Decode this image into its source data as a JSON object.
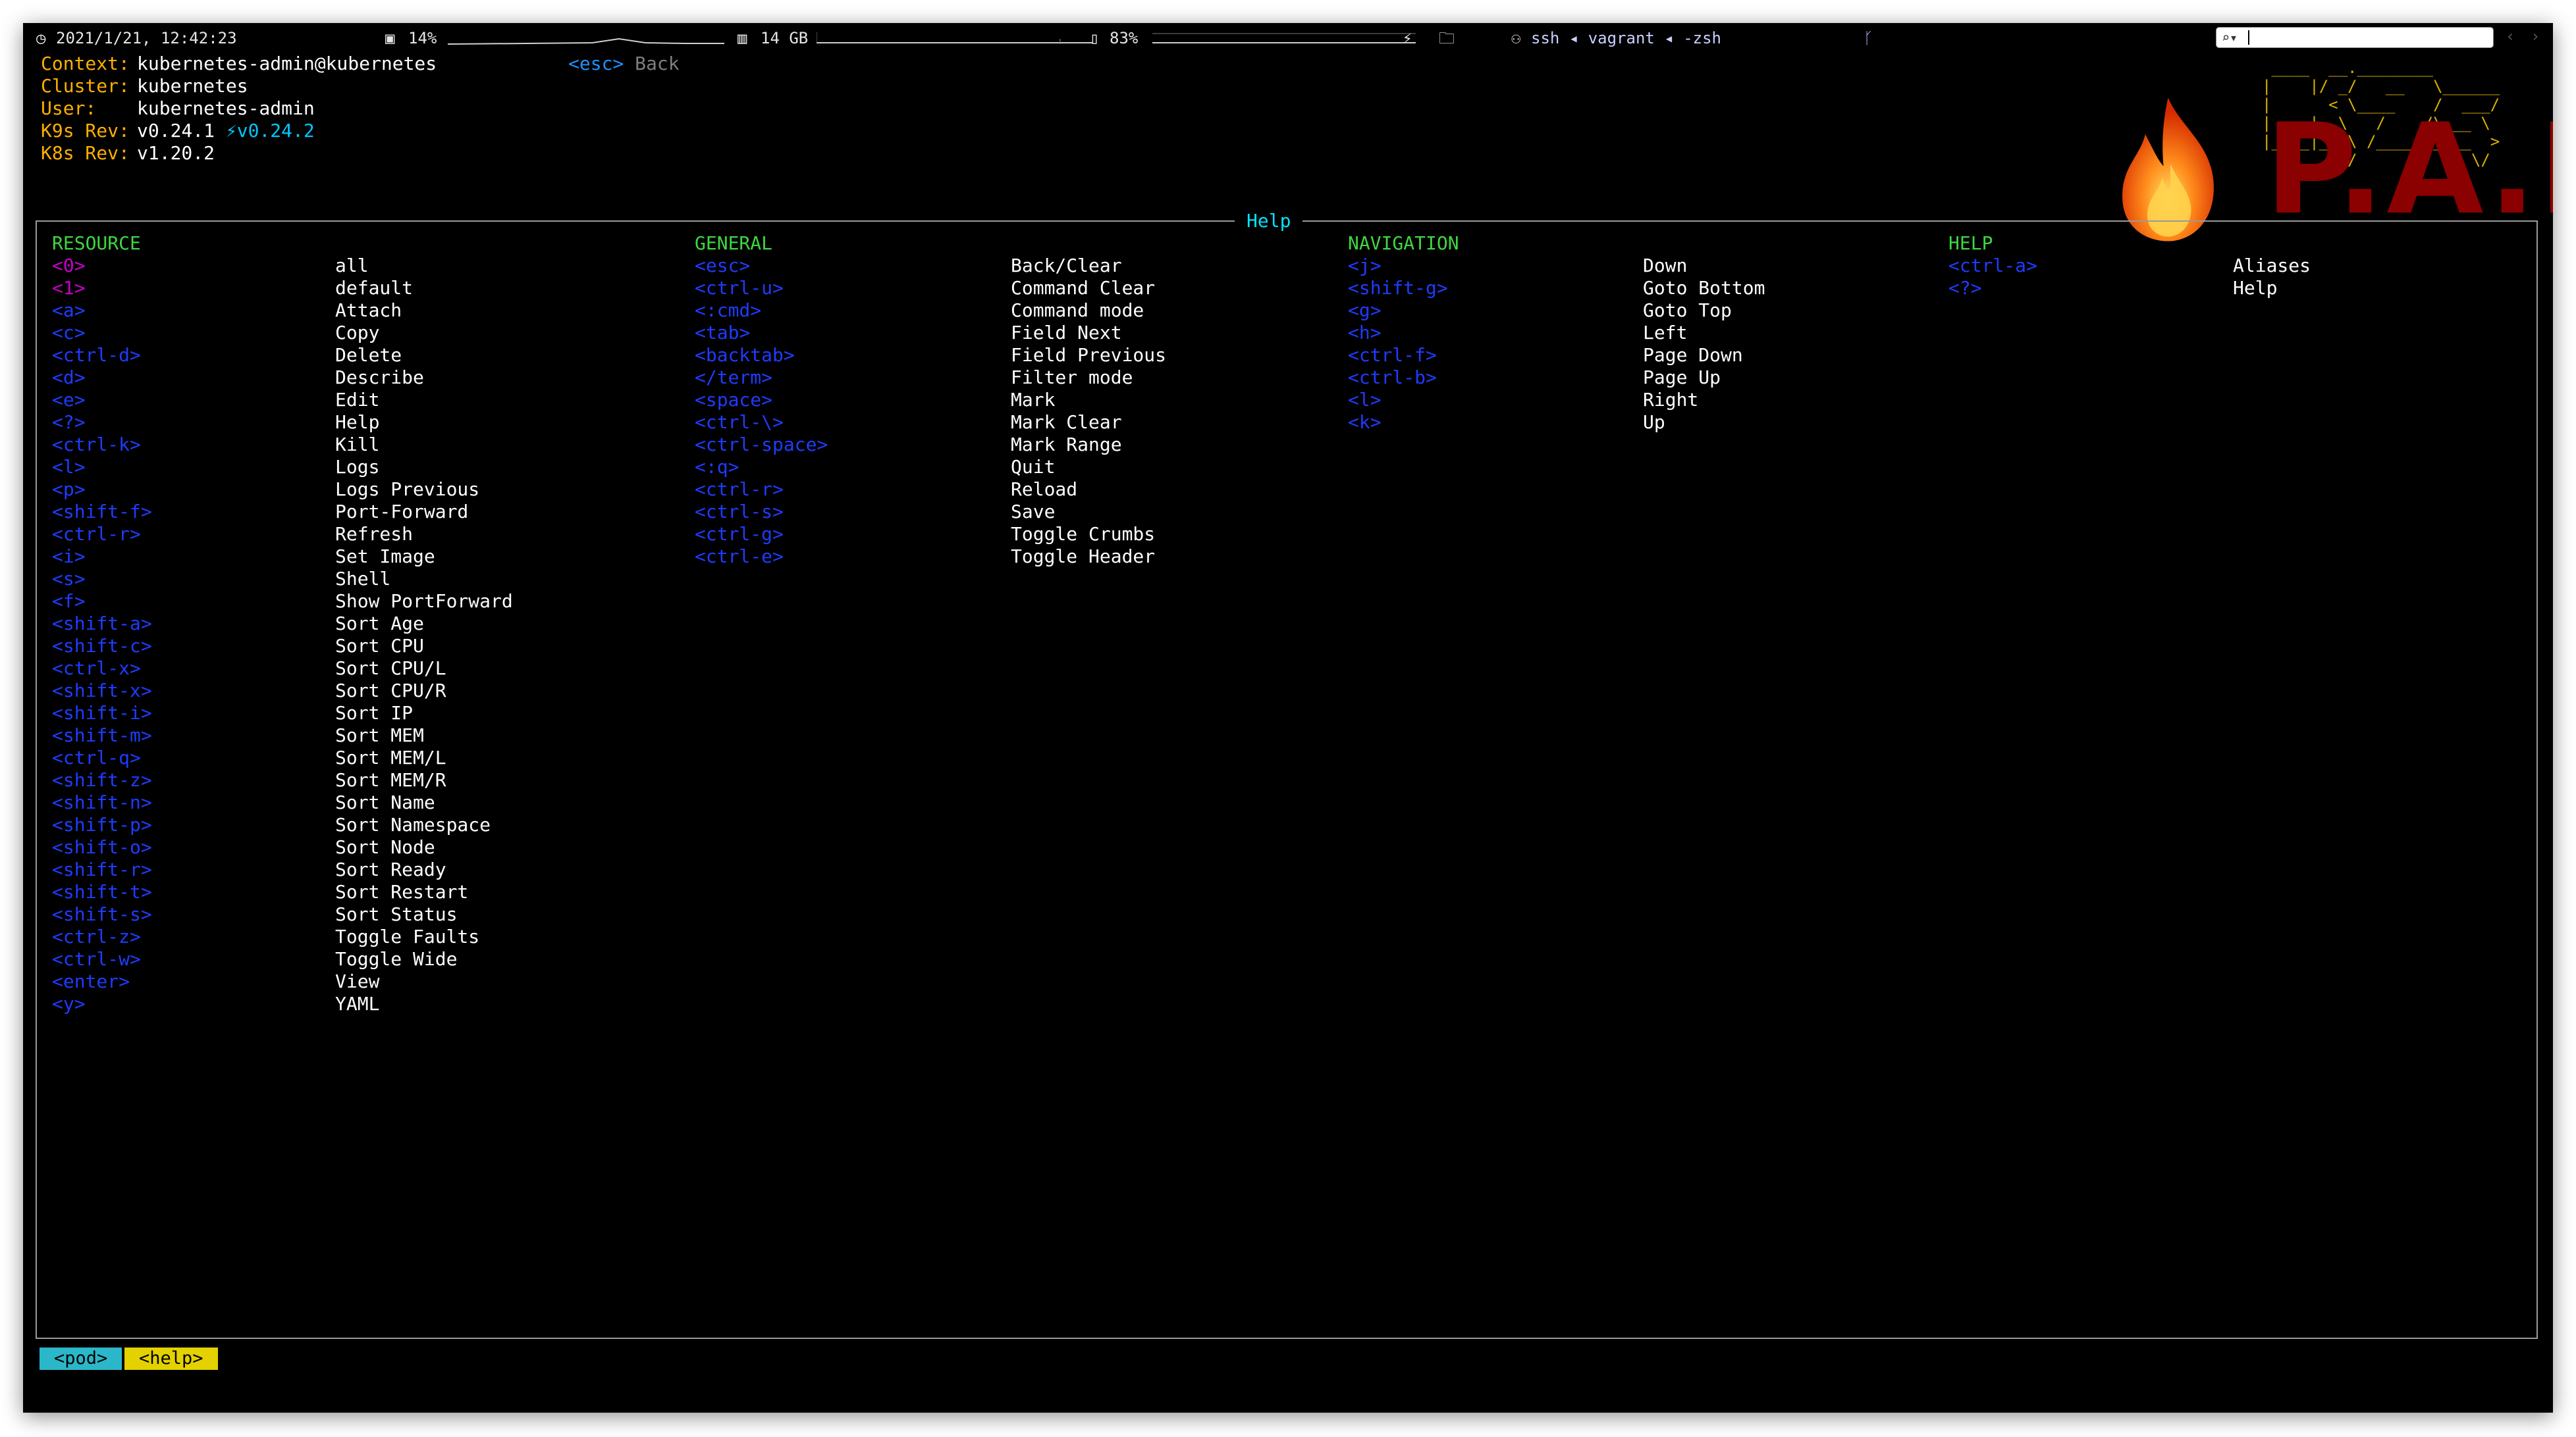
{
  "status_bar": {
    "datetime": "2021/1/21, 12:42:23",
    "cpu": "14%",
    "memory": "14 GB",
    "battery": "83%",
    "session": "ssh ◂ vagrant ◂ -zsh",
    "search_value": ""
  },
  "header": {
    "context_label": "Context:",
    "context": "kubernetes-admin@kubernetes",
    "cluster_label": "Cluster:",
    "cluster": "kubernetes",
    "user_label": "User:",
    "user": "kubernetes-admin",
    "k9s_rev_label": "K9s Rev:",
    "k9s_rev": "v0.24.1",
    "k9s_update": "⚡v0.24.2",
    "k8s_rev_label": "K8s Rev:",
    "k8s_rev": "v1.20.2",
    "hint_key": "<esc>",
    "hint_desc": "Back"
  },
  "logo": {
    "ascii": " ____  __.________\n|    |/ _/   __   \\______\n|      < \\____    /  ___/\n|    |  \\   /    /\\___ \\\n|____|__ \\ /____//____  >\n        \\/            \\/",
    "text": "P.A.I"
  },
  "help_title": "Help",
  "resource": {
    "title": "RESOURCE",
    "items": [
      {
        "key": "<0>",
        "desc": "all"
      },
      {
        "key": "<1>",
        "desc": "default"
      },
      {
        "key": "<a>",
        "desc": "Attach"
      },
      {
        "key": "<c>",
        "desc": "Copy"
      },
      {
        "key": "<ctrl-d>",
        "desc": "Delete"
      },
      {
        "key": "<d>",
        "desc": "Describe"
      },
      {
        "key": "<e>",
        "desc": "Edit"
      },
      {
        "key": "<?>",
        "desc": "Help"
      },
      {
        "key": "<ctrl-k>",
        "desc": "Kill"
      },
      {
        "key": "<l>",
        "desc": "Logs"
      },
      {
        "key": "<p>",
        "desc": "Logs Previous"
      },
      {
        "key": "<shift-f>",
        "desc": "Port-Forward"
      },
      {
        "key": "<ctrl-r>",
        "desc": "Refresh"
      },
      {
        "key": "<i>",
        "desc": "Set Image"
      },
      {
        "key": "<s>",
        "desc": "Shell"
      },
      {
        "key": "<f>",
        "desc": "Show PortForward"
      },
      {
        "key": "<shift-a>",
        "desc": "Sort Age"
      },
      {
        "key": "<shift-c>",
        "desc": "Sort CPU"
      },
      {
        "key": "<ctrl-x>",
        "desc": "Sort CPU/L"
      },
      {
        "key": "<shift-x>",
        "desc": "Sort CPU/R"
      },
      {
        "key": "<shift-i>",
        "desc": "Sort IP"
      },
      {
        "key": "<shift-m>",
        "desc": "Sort MEM"
      },
      {
        "key": "<ctrl-q>",
        "desc": "Sort MEM/L"
      },
      {
        "key": "<shift-z>",
        "desc": "Sort MEM/R"
      },
      {
        "key": "<shift-n>",
        "desc": "Sort Name"
      },
      {
        "key": "<shift-p>",
        "desc": "Sort Namespace"
      },
      {
        "key": "<shift-o>",
        "desc": "Sort Node"
      },
      {
        "key": "<shift-r>",
        "desc": "Sort Ready"
      },
      {
        "key": "<shift-t>",
        "desc": "Sort Restart"
      },
      {
        "key": "<shift-s>",
        "desc": "Sort Status"
      },
      {
        "key": "<ctrl-z>",
        "desc": "Toggle Faults"
      },
      {
        "key": "<ctrl-w>",
        "desc": "Toggle Wide"
      },
      {
        "key": "<enter>",
        "desc": "View"
      },
      {
        "key": "<y>",
        "desc": "YAML"
      }
    ]
  },
  "general": {
    "title": "GENERAL",
    "items": [
      {
        "key": "<esc>",
        "desc": "Back/Clear"
      },
      {
        "key": "<ctrl-u>",
        "desc": "Command Clear"
      },
      {
        "key": "<:cmd>",
        "desc": "Command mode"
      },
      {
        "key": "<tab>",
        "desc": "Field Next"
      },
      {
        "key": "<backtab>",
        "desc": "Field Previous"
      },
      {
        "key": "</term>",
        "desc": "Filter mode"
      },
      {
        "key": "<space>",
        "desc": "Mark"
      },
      {
        "key": "<ctrl-\\>",
        "desc": "Mark Clear"
      },
      {
        "key": "<ctrl-space>",
        "desc": "Mark Range"
      },
      {
        "key": "<:q>",
        "desc": "Quit"
      },
      {
        "key": "<ctrl-r>",
        "desc": "Reload"
      },
      {
        "key": "<ctrl-s>",
        "desc": "Save"
      },
      {
        "key": "<ctrl-g>",
        "desc": "Toggle Crumbs"
      },
      {
        "key": "<ctrl-e>",
        "desc": "Toggle Header"
      }
    ]
  },
  "navigation": {
    "title": "NAVIGATION",
    "items": [
      {
        "key": "<j>",
        "desc": "Down"
      },
      {
        "key": "<shift-g>",
        "desc": "Goto Bottom"
      },
      {
        "key": "<g>",
        "desc": "Goto Top"
      },
      {
        "key": "<h>",
        "desc": "Left"
      },
      {
        "key": "<ctrl-f>",
        "desc": "Page Down"
      },
      {
        "key": "<ctrl-b>",
        "desc": "Page Up"
      },
      {
        "key": "<l>",
        "desc": "Right"
      },
      {
        "key": "<k>",
        "desc": "Up"
      }
    ]
  },
  "help": {
    "title": "HELP",
    "items": [
      {
        "key": "<ctrl-a>",
        "desc": "Aliases"
      },
      {
        "key": "<?>",
        "desc": "Help"
      }
    ]
  },
  "crumbs": [
    "<pod>",
    "<help>"
  ],
  "colors": {
    "background": "#000000",
    "header_key": "#ffb000",
    "section_title": "#3ed73e",
    "shortcut_key": "#1e3cff",
    "numeric_key": "#c800c8",
    "frame_title": "#00e5ff",
    "crumb_pod": "#2ab7c9",
    "crumb_help": "#e3d100"
  }
}
